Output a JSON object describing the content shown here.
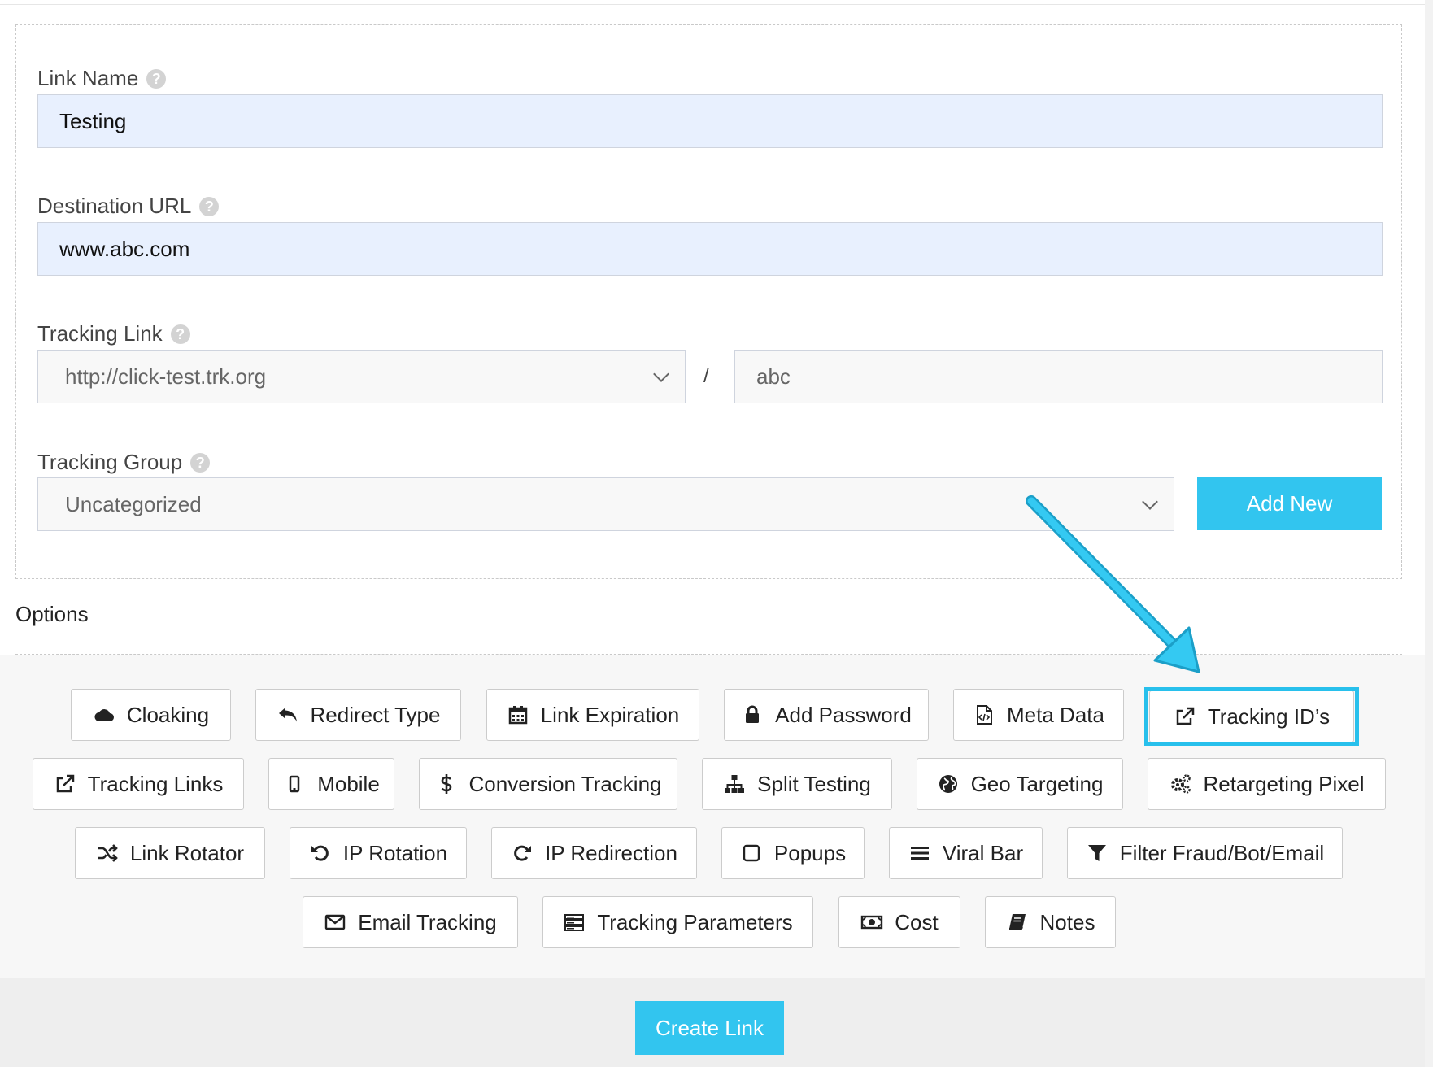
{
  "form": {
    "link_name": {
      "label": "Link Name",
      "value": "Testing"
    },
    "destination_url": {
      "label": "Destination URL",
      "value": "www.abc.com"
    },
    "tracking_link": {
      "label": "Tracking Link",
      "domain": "http://click-test.trk.org",
      "separator": "/",
      "slug": "abc"
    },
    "tracking_group": {
      "label": "Tracking Group",
      "selected": "Uncategorized",
      "add_new_label": "Add New"
    },
    "help_glyph": "?"
  },
  "options": {
    "title": "Options",
    "buttons": [
      {
        "label": "Cloaking",
        "icon": "cloud-icon"
      },
      {
        "label": "Redirect Type",
        "icon": "reply-icon"
      },
      {
        "label": "Link Expiration",
        "icon": "calendar-icon"
      },
      {
        "label": "Add Password",
        "icon": "lock-icon"
      },
      {
        "label": "Meta Data",
        "icon": "code-file-icon"
      },
      {
        "label": "Tracking ID’s",
        "icon": "external-link-icon"
      },
      {
        "label": "Tracking Links",
        "icon": "external-link-icon"
      },
      {
        "label": "Mobile",
        "icon": "mobile-icon"
      },
      {
        "label": "Conversion Tracking",
        "icon": "dollar-icon"
      },
      {
        "label": "Split Testing",
        "icon": "sitemap-icon"
      },
      {
        "label": "Geo Targeting",
        "icon": "globe-icon"
      },
      {
        "label": "Retargeting Pixel",
        "icon": "gears-icon"
      },
      {
        "label": "Link Rotator",
        "icon": "shuffle-icon"
      },
      {
        "label": "IP Rotation",
        "icon": "undo-icon"
      },
      {
        "label": "IP Redirection",
        "icon": "redo-icon"
      },
      {
        "label": "Popups",
        "icon": "square-icon"
      },
      {
        "label": "Viral Bar",
        "icon": "bars-icon"
      },
      {
        "label": "Filter Fraud/Bot/Email",
        "icon": "filter-icon"
      },
      {
        "label": "Email Tracking",
        "icon": "envelope-icon"
      },
      {
        "label": "Tracking Parameters",
        "icon": "server-icon"
      },
      {
        "label": "Cost",
        "icon": "money-icon"
      },
      {
        "label": "Notes",
        "icon": "book-icon"
      }
    ]
  },
  "footer": {
    "create_label": "Create Link"
  },
  "colors": {
    "accent": "#32c5ef",
    "highlight": "#28c0ec",
    "input_blue": "#e8f0fe"
  }
}
